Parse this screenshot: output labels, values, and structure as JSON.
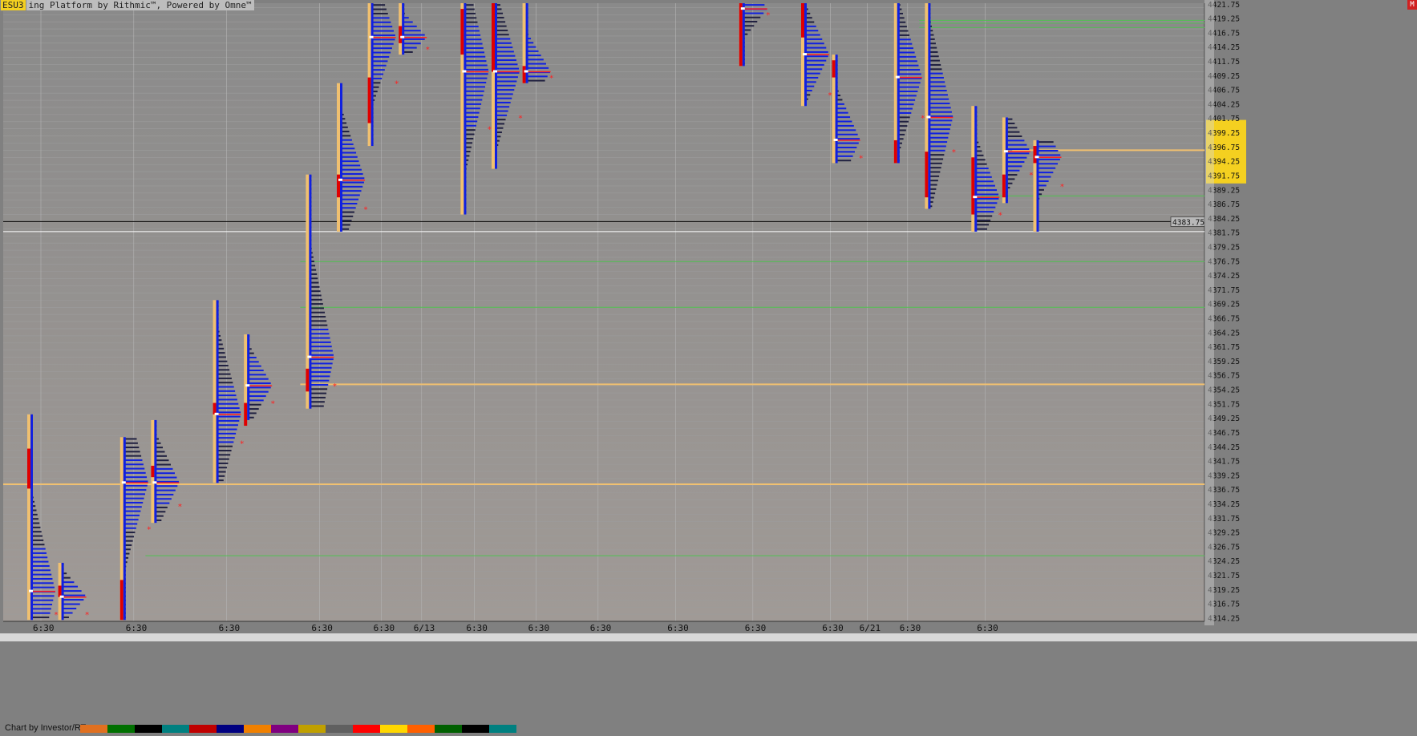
{
  "window": {
    "symbol": "ESU3",
    "title": "ing Platform by Rithmic™, Powered by Omne™",
    "credit": "Chart by Investor/RT",
    "corner_button": "M"
  },
  "chart_data": {
    "type": "market-profile",
    "ylim": [
      4313.75,
      4422.0
    ],
    "tick_step": 1.25,
    "current_price": "4383.75",
    "highlighted_range": [
      4391.0,
      4401.0
    ],
    "x_labels": [
      {
        "text": "6:30",
        "col": 0
      },
      {
        "text": "6:30",
        "col": 3
      },
      {
        "text": "6:30",
        "col": 6
      },
      {
        "text": "6:30",
        "col": 9
      },
      {
        "text": "6:30",
        "col": 11
      },
      {
        "text": "6/13",
        "col": 12.3
      },
      {
        "text": "6:30",
        "col": 14
      },
      {
        "text": "6:30",
        "col": 16
      },
      {
        "text": "6:30",
        "col": 18
      },
      {
        "text": "6:30",
        "col": 20.5
      },
      {
        "text": "6:30",
        "col": 23
      },
      {
        "text": "6:30",
        "col": 25.5
      },
      {
        "text": "6/21",
        "col": 26.7
      },
      {
        "text": "6:30",
        "col": 28
      },
      {
        "text": "6:30",
        "col": 30.5
      }
    ],
    "levels": [
      {
        "price": 4337.75,
        "color": "#f0c070",
        "from": 0
      },
      {
        "price": 4355.25,
        "color": "#f0c070",
        "from": 9
      },
      {
        "price": 4396.25,
        "color": "#f0c070",
        "from": 32
      },
      {
        "price": 4382.0,
        "color": "#ffffff",
        "from": 0
      },
      {
        "price": 4383.75,
        "color": "#000000",
        "from": 0
      },
      {
        "price": 4325.25,
        "color": "#50c050",
        "from": 4
      },
      {
        "price": 4368.75,
        "color": "#50c050",
        "from": 9
      },
      {
        "price": 4376.75,
        "color": "#50c050",
        "from": 9
      },
      {
        "price": 4388.25,
        "color": "#50c050",
        "from": 31
      },
      {
        "price": 4419.0,
        "color": "#50c050",
        "from": 29
      },
      {
        "price": 4418.5,
        "color": "#50c050",
        "from": 29
      },
      {
        "price": 4417.75,
        "color": "#50c050",
        "from": 29
      }
    ],
    "profiles": [
      {
        "col": 0,
        "low": 4314,
        "high": 4350,
        "poc": 4319,
        "vah": 4327,
        "val": 4315,
        "ib": [
          4337,
          4344
        ],
        "tail": [
          4337,
          4340
        ]
      },
      {
        "col": 1,
        "low": 4314,
        "high": 4324,
        "poc": 4318,
        "vah": 4321,
        "val": 4315,
        "ib": [
          4318,
          4320
        ]
      },
      {
        "col": 3,
        "low": 4314,
        "high": 4346,
        "poc": 4338,
        "vah": 4342,
        "val": 4330,
        "ib": [
          4314,
          4321
        ]
      },
      {
        "col": 4,
        "low": 4331,
        "high": 4349,
        "poc": 4338,
        "vah": 4341,
        "val": 4334,
        "ib": [
          4339,
          4341
        ]
      },
      {
        "col": 6,
        "low": 4338,
        "high": 4370,
        "poc": 4350,
        "vah": 4355,
        "val": 4345,
        "ib": [
          4350,
          4352
        ]
      },
      {
        "col": 7,
        "low": 4349,
        "high": 4364,
        "poc": 4355,
        "vah": 4360,
        "val": 4352,
        "ib": [
          4348,
          4352
        ]
      },
      {
        "col": 9,
        "low": 4351,
        "high": 4392,
        "poc": 4360,
        "vah": 4365,
        "val": 4355,
        "ib": [
          4354,
          4358
        ]
      },
      {
        "col": 10,
        "low": 4382,
        "high": 4408,
        "poc": 4391,
        "vah": 4398,
        "val": 4386,
        "ib": [
          4388,
          4392
        ]
      },
      {
        "col": 11,
        "low": 4397,
        "high": 4422,
        "poc": 4416,
        "vah": 4420,
        "val": 4408,
        "ib": [
          4401,
          4409
        ]
      },
      {
        "col": 12,
        "low": 4413,
        "high": 4422,
        "poc": 4416,
        "vah": 4420,
        "val": 4414,
        "ib": [
          4415,
          4418
        ]
      },
      {
        "col": 14,
        "low": 4385,
        "high": 4422,
        "poc": 4410,
        "vah": 4418,
        "val": 4400,
        "ib": [
          4413,
          4421
        ]
      },
      {
        "col": 15,
        "low": 4393,
        "high": 4422,
        "poc": 4410,
        "vah": 4416,
        "val": 4402,
        "ib": [
          4410,
          4422
        ]
      },
      {
        "col": 16,
        "low": 4408,
        "high": 4422,
        "poc": 4410,
        "vah": 4416,
        "val": 4409,
        "ib": [
          4408,
          4411
        ]
      },
      {
        "col": 23,
        "low": 4411,
        "high": 4422,
        "poc": 4421,
        "vah": 4422,
        "val": 4420,
        "ib": [
          4411,
          4422
        ]
      },
      {
        "col": 25,
        "low": 4404,
        "high": 4422,
        "poc": 4413,
        "vah": 4418,
        "val": 4406,
        "ib": [
          4416,
          4422
        ]
      },
      {
        "col": 26,
        "low": 4394,
        "high": 4413,
        "poc": 4398,
        "vah": 4405,
        "val": 4395,
        "ib": [
          4409,
          4412
        ]
      },
      {
        "col": 28,
        "low": 4394,
        "high": 4422,
        "poc": 4409,
        "vah": 4416,
        "val": 4402,
        "ib": [
          4394,
          4398
        ]
      },
      {
        "col": 29,
        "low": 4386,
        "high": 4422,
        "poc": 4402,
        "vah": 4410,
        "val": 4396,
        "ib": [
          4388,
          4396
        ]
      },
      {
        "col": 30.5,
        "low": 4382,
        "high": 4404,
        "poc": 4388,
        "vah": 4393,
        "val": 4385,
        "ib": [
          4385,
          4395
        ]
      },
      {
        "col": 31.5,
        "low": 4387,
        "high": 4402,
        "poc": 4396,
        "vah": 4398,
        "val": 4392,
        "ib": [
          4388,
          4392
        ]
      },
      {
        "col": 32.5,
        "low": 4382,
        "high": 4398,
        "poc": 4395,
        "vah": 4397,
        "val": 4390,
        "ib": [
          4394,
          4397
        ]
      }
    ]
  },
  "status_colors": [
    "#e07020",
    "#007000",
    "#000000",
    "#008080",
    "#c00000",
    "#000080",
    "#f08000",
    "#800080",
    "#c0a000",
    "#606060",
    "#ff0000",
    "#ffd700",
    "#ff6000",
    "#006000",
    "#000000",
    "#008080"
  ]
}
